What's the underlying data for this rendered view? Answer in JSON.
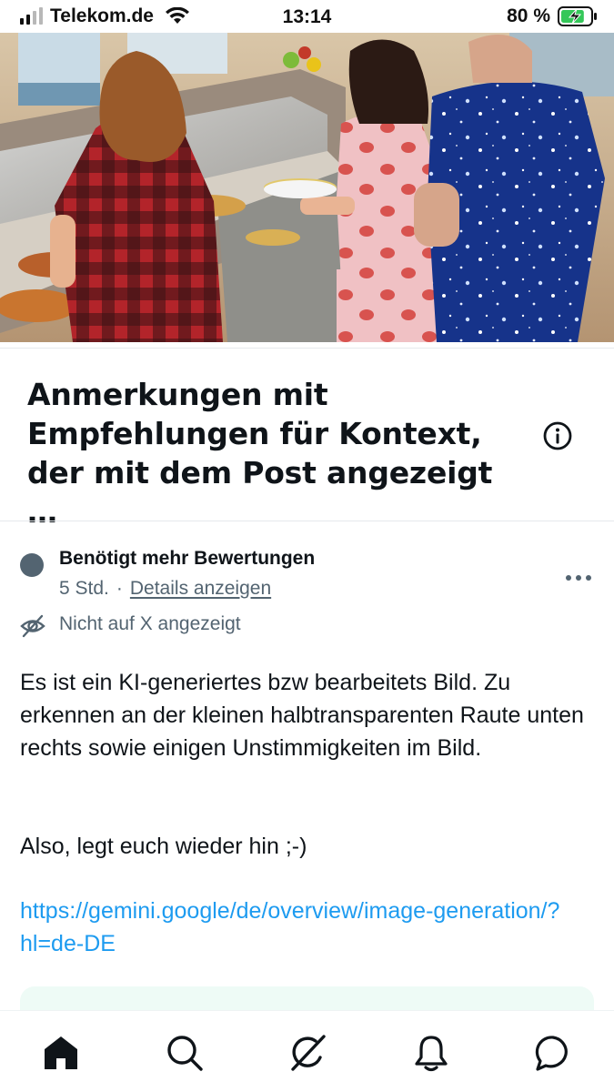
{
  "status_bar": {
    "carrier": "Telekom.de",
    "time": "13:14",
    "battery_percent": "80 %",
    "battery_level": 0.8,
    "signal_bars": 2
  },
  "post_image": {
    "description_icon": "photo"
  },
  "note": {
    "title": "Anmerkungen mit Empfehlungen für Kontext, der mit dem Post angezeigt …",
    "status": "Benötigt mehr Bewertungen",
    "age": "5 Std.",
    "separator": "·",
    "details_link": "Details anzeigen",
    "visibility": "Nicht auf X angezeigt",
    "body_paragraph_1": "Es ist ein KI-generiertes bzw bearbeitets Bild. Zu erkennen an der kleinen halbtransparenten Raute unten rechts sowie einigen Unstimmigkeiten im Bild.",
    "body_paragraph_2": "Also, legt euch wieder hin ;-)",
    "link": "https://gemini.google/de/overview/image-generation/?hl=de-DE"
  },
  "bottom_nav": {
    "items": [
      "home",
      "search",
      "grok",
      "notifications",
      "messages"
    ],
    "active": "home"
  },
  "colors": {
    "text_primary": "#0f1419",
    "text_secondary": "#536471",
    "link": "#1d9bf0",
    "status_dot": "#536471",
    "battery_green": "#34c759"
  }
}
